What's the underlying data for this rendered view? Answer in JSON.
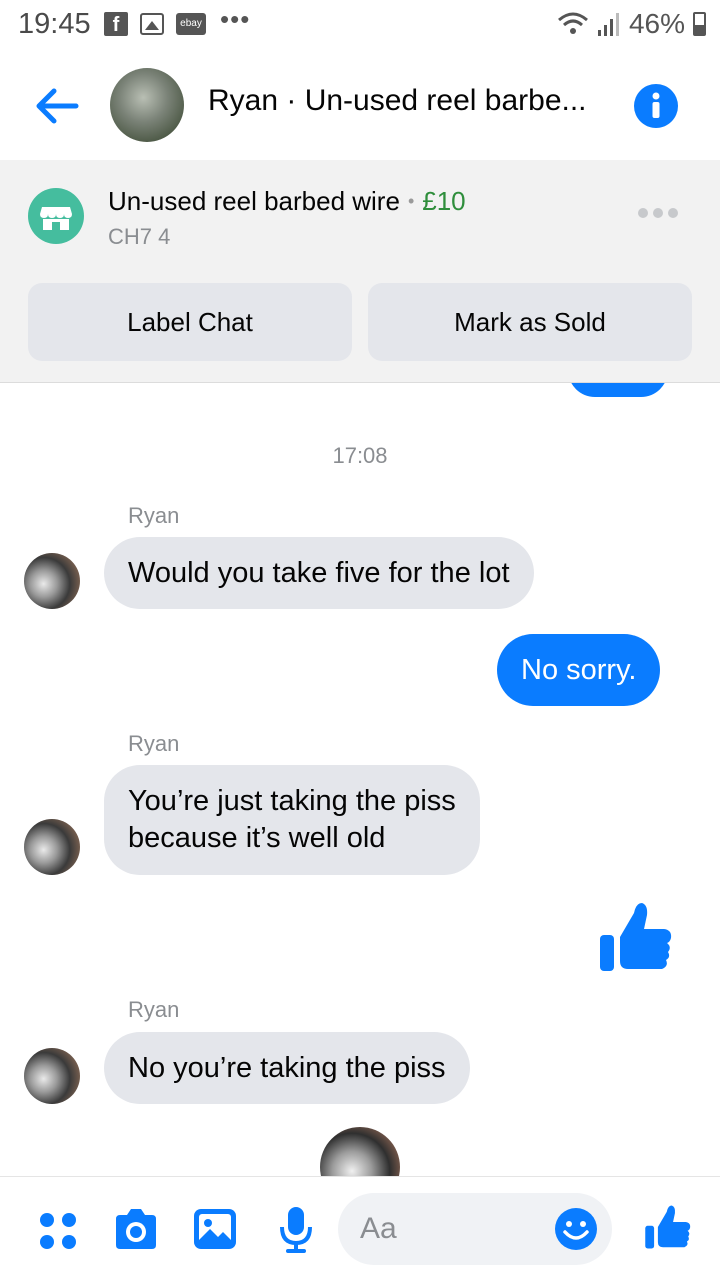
{
  "status_bar": {
    "time": "19:45",
    "icons": [
      "facebook-icon",
      "gallery-icon",
      "ebay-icon",
      "more-notifications-icon"
    ],
    "ebay_label": "ebay",
    "dots": "•••",
    "battery": "46%"
  },
  "header": {
    "title": "Ryan · Un-used reel barbe...",
    "icons": [
      "back-arrow-icon",
      "info-icon"
    ]
  },
  "listing": {
    "title": "Un-used reel barbed wire",
    "separator": "•",
    "price": "£10",
    "location": "CH7 4",
    "label_chat_button": "Label Chat",
    "mark_sold_button": "Mark as Sold"
  },
  "chat": {
    "timestamp": "17:08",
    "messages": [
      {
        "sender": "Ryan",
        "text": "Would you take five for the lot",
        "direction": "incoming"
      },
      {
        "text": "No sorry.",
        "direction": "outgoing"
      },
      {
        "sender": "Ryan",
        "line1": "You’re just taking the piss",
        "line2": "because it’s well old",
        "direction": "incoming"
      },
      {
        "type": "like-sticker",
        "direction": "outgoing"
      },
      {
        "sender": "Ryan",
        "text": "No you’re taking the piss",
        "direction": "incoming"
      }
    ]
  },
  "composer": {
    "placeholder": "Aa",
    "icons": [
      "apps-icon",
      "camera-icon",
      "image-icon",
      "microphone-icon",
      "emoji-icon",
      "thumbs-up-icon"
    ]
  },
  "colors": {
    "accent": "#0a7cff",
    "bubble_incoming": "#e4e6eb",
    "price_green": "#2f8e3c",
    "store_icon": "#45bd9e"
  }
}
